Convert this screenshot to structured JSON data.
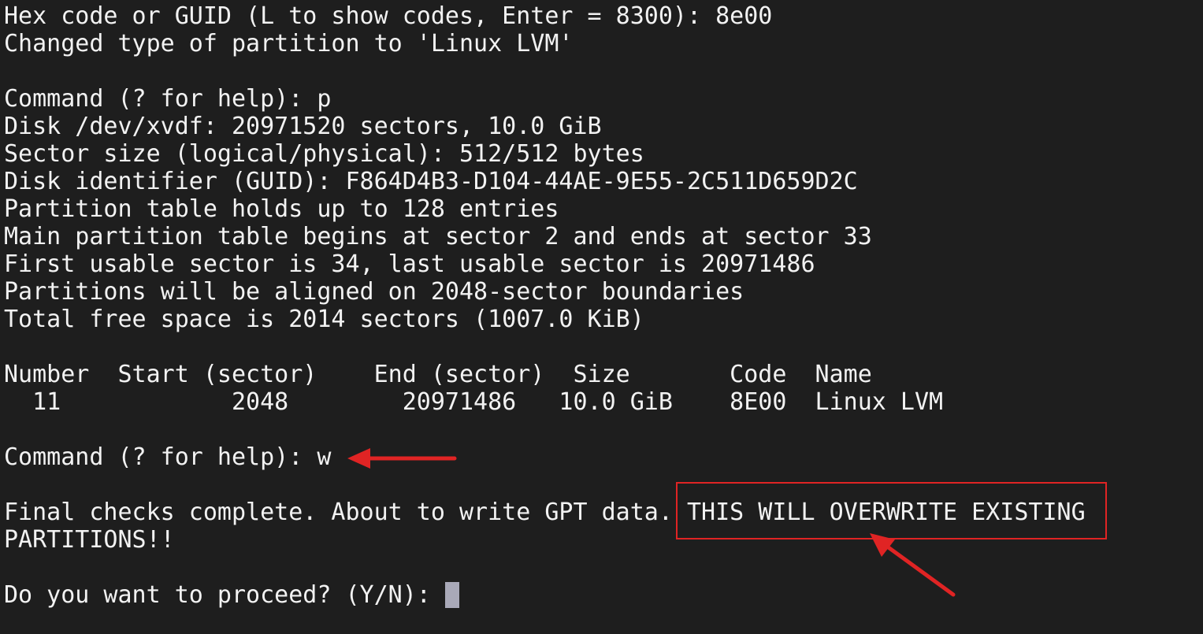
{
  "terminal": {
    "lines": [
      "Hex code or GUID (L to show codes, Enter = 8300): 8e00",
      "Changed type of partition to 'Linux LVM'",
      "",
      "Command (? for help): p",
      "Disk /dev/xvdf: 20971520 sectors, 10.0 GiB",
      "Sector size (logical/physical): 512/512 bytes",
      "Disk identifier (GUID): F864D4B3-D104-44AE-9E55-2C511D659D2C",
      "Partition table holds up to 128 entries",
      "Main partition table begins at sector 2 and ends at sector 33",
      "First usable sector is 34, last usable sector is 20971486",
      "Partitions will be aligned on 2048-sector boundaries",
      "Total free space is 2014 sectors (1007.0 KiB)",
      "",
      "Number  Start (sector)    End (sector)  Size       Code  Name",
      "  11            2048        20971486   10.0 GiB    8E00  Linux LVM",
      "",
      "Command (? for help): w",
      "",
      "Final checks complete. About to write GPT data. THIS WILL OVERWRITE EXISTING",
      "PARTITIONS!!",
      "",
      "Do you want to proceed? (Y/N): "
    ]
  },
  "colors": {
    "background": "#1e1e1e",
    "text": "#f2f2f2",
    "annotation": "#e02424",
    "cursor": "#a9a9b8"
  }
}
